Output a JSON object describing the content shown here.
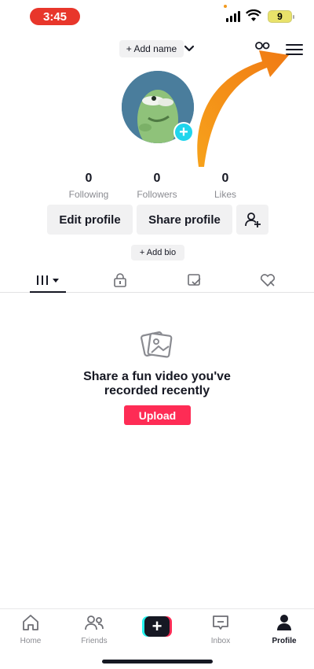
{
  "status_bar": {
    "time": "3:45",
    "battery": "9",
    "time_pill_color": "#e8362b",
    "battery_color": "#e9e26a"
  },
  "header": {
    "add_name": "+ Add name",
    "icons": [
      "chevron-down-icon",
      "people-icon",
      "menu-icon"
    ],
    "annotation": "orange-arrow-pointing-to-menu"
  },
  "profile": {
    "avatar": "green-character-avatar",
    "avatar_badge": "+",
    "stats": [
      {
        "value": "0",
        "label": "Following"
      },
      {
        "value": "0",
        "label": "Followers"
      },
      {
        "value": "0",
        "label": "Likes"
      }
    ],
    "buttons": {
      "edit": "Edit profile",
      "share": "Share profile",
      "add_friend_icon": "add-user-icon"
    },
    "add_bio": "+ Add bio"
  },
  "tabs": [
    {
      "name": "videos",
      "icon": "grid-icon",
      "active": true
    },
    {
      "name": "private",
      "icon": "lock-icon",
      "active": false
    },
    {
      "name": "reposts",
      "icon": "repost-icon",
      "active": false
    },
    {
      "name": "liked",
      "icon": "liked-heart-icon",
      "active": false
    }
  ],
  "empty_state": {
    "icon": "photos-icon",
    "title_line1": "Share a fun video you've",
    "title_line2": "recorded recently",
    "upload": "Upload",
    "upload_color": "#fe2c55"
  },
  "bottom_nav": {
    "items": [
      {
        "label": "Home",
        "icon": "home-icon",
        "active": false
      },
      {
        "label": "Friends",
        "icon": "friends-icon",
        "active": false
      },
      {
        "label": "",
        "icon": "create-plus-icon",
        "active": false
      },
      {
        "label": "Inbox",
        "icon": "inbox-icon",
        "active": false
      },
      {
        "label": "Profile",
        "icon": "profile-icon",
        "active": true
      }
    ]
  },
  "colors": {
    "accent_red": "#fe2c55",
    "accent_cyan": "#25f4ee",
    "badge_cyan": "#20d5ec",
    "arrow_orange": "#f28a1a"
  }
}
